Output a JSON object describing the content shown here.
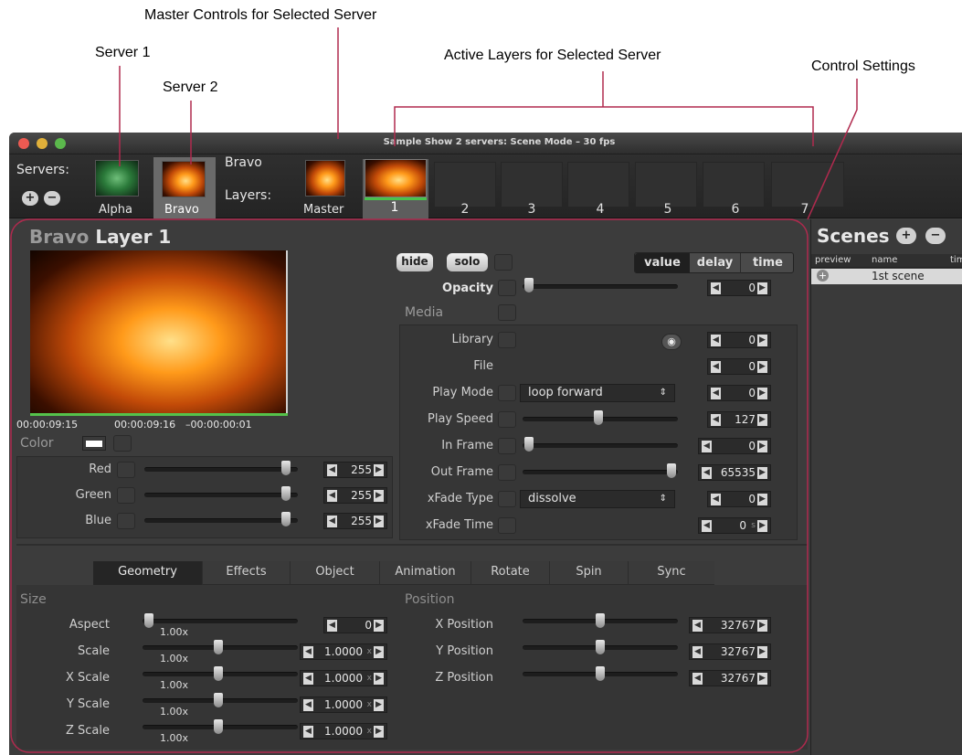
{
  "annotations": {
    "master": "Master Controls for Selected Server",
    "server1": "Server 1",
    "server2": "Server 2",
    "active": "Active Layers for Selected Server",
    "control": "Control Settings"
  },
  "window": {
    "title": "Sample Show 2 servers: Scene Mode – 30 fps"
  },
  "toolbar": {
    "servers_label": "Servers:",
    "servers": [
      "Alpha",
      "Bravo"
    ],
    "current_server": "Bravo",
    "layers_label": "Layers:",
    "master_label": "Master",
    "layer_numbers": [
      "1",
      "2",
      "3",
      "4",
      "5",
      "6",
      "7"
    ]
  },
  "panel": {
    "title_server": "Bravo",
    "title_layer": "Layer 1",
    "timecode": {
      "start": "00:00:09:15",
      "current": "00:00:09:16",
      "remaining": "–00:00:00:01"
    },
    "color_label": "Color",
    "hide": "hide",
    "solo": "solo",
    "modes": [
      "value",
      "delay",
      "time"
    ],
    "opacity": {
      "label": "Opacity",
      "value": "0"
    },
    "media_label": "Media",
    "colors": [
      {
        "label": "Red",
        "value": "255"
      },
      {
        "label": "Green",
        "value": "255"
      },
      {
        "label": "Blue",
        "value": "255"
      }
    ],
    "media": [
      {
        "label": "Library",
        "value": "0"
      },
      {
        "label": "File",
        "value": "0"
      },
      {
        "label": "Play Mode",
        "value": "0",
        "select": "loop forward"
      },
      {
        "label": "Play Speed",
        "value": "127"
      },
      {
        "label": "In Frame",
        "value": "0"
      },
      {
        "label": "Out Frame",
        "value": "65535"
      },
      {
        "label": "xFade Type",
        "value": "0",
        "select": "dissolve"
      },
      {
        "label": "xFade Time",
        "value": "0",
        "unit": "s"
      }
    ],
    "tabs": [
      "Geometry",
      "Effects",
      "Object",
      "Animation",
      "Rotate",
      "Spin",
      "Sync"
    ],
    "size_label": "Size",
    "position_label": "Position",
    "size": [
      {
        "label": "Aspect",
        "value": "0",
        "sub": "1.00x"
      },
      {
        "label": "Scale",
        "value": "1.0000",
        "unit": "x",
        "sub": "1.00x"
      },
      {
        "label": "X Scale",
        "value": "1.0000",
        "unit": "x",
        "sub": "1.00x"
      },
      {
        "label": "Y Scale",
        "value": "1.0000",
        "unit": "x",
        "sub": "1.00x"
      },
      {
        "label": "Z Scale",
        "value": "1.0000",
        "unit": "x",
        "sub": "1.00x"
      }
    ],
    "position": [
      {
        "label": "X Position",
        "value": "32767"
      },
      {
        "label": "Y Position",
        "value": "32767"
      },
      {
        "label": "Z Position",
        "value": "32767"
      }
    ]
  },
  "scenes": {
    "title": "Scenes",
    "columns": [
      "preview",
      "name",
      "tim"
    ],
    "items": [
      {
        "name": "1st scene"
      }
    ]
  }
}
